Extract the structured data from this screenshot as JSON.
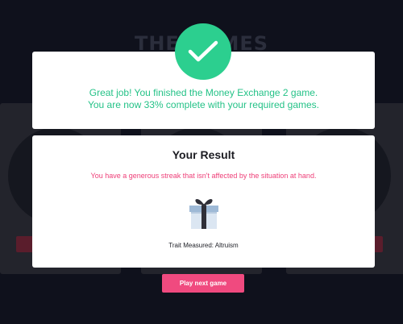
{
  "background": {
    "heading": "THE GAMES"
  },
  "completion": {
    "line1": "Great job! You finished the Money Exchange 2 game.",
    "line2": "You are now 33% complete with your required games.",
    "percent_complete": 33,
    "accent_color": "#2ccf8f"
  },
  "result": {
    "title": "Your Result",
    "description": "You have a generous streak that isn't affected by the situation at hand.",
    "icon": "gift-icon",
    "trait_label": "Trait Measured: Altruism",
    "description_color": "#ee3f78"
  },
  "actions": {
    "play_next_label": "Play next game",
    "button_color": "#f04a7f"
  }
}
